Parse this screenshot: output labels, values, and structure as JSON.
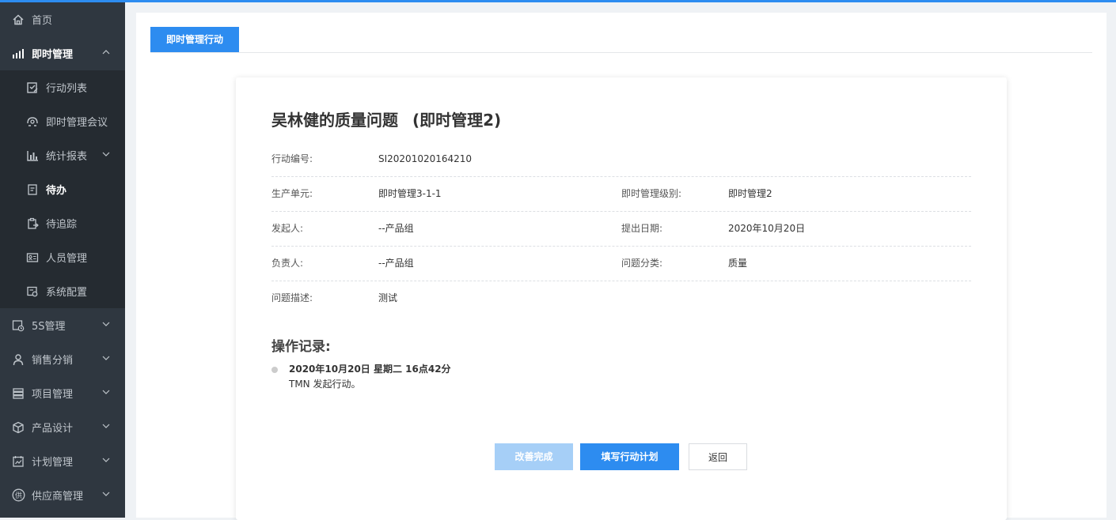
{
  "sidebar": {
    "items": [
      {
        "label": "首页",
        "icon": "home-icon"
      },
      {
        "label": "即时管理",
        "icon": "bar-signal-icon"
      },
      {
        "label": "行动列表",
        "icon": "edit-check-icon"
      },
      {
        "label": "即时管理会议",
        "icon": "meeting-icon"
      },
      {
        "label": "统计报表",
        "icon": "bar-chart-icon"
      },
      {
        "label": "待办",
        "icon": "todo-icon"
      },
      {
        "label": "待追踪",
        "icon": "tracking-icon"
      },
      {
        "label": "人员管理",
        "icon": "id-card-icon"
      },
      {
        "label": "系统配置",
        "icon": "config-icon"
      },
      {
        "label": "5S管理",
        "icon": "calendar-clock-icon"
      },
      {
        "label": "销售分销",
        "icon": "user-icon"
      },
      {
        "label": "项目管理",
        "icon": "server-icon"
      },
      {
        "label": "产品设计",
        "icon": "cube-icon"
      },
      {
        "label": "计划管理",
        "icon": "plan-icon"
      },
      {
        "label": "供应商管理",
        "icon": "supplier-icon",
        "badge": "供"
      }
    ]
  },
  "tab": {
    "label": "即时管理行动"
  },
  "card": {
    "title": "吴林健的质量问题",
    "level_title": "(即时管理2)",
    "fields": {
      "action_no_label": "行动编号:",
      "action_no": "SI20201020164210",
      "unit_label": "生产单元:",
      "unit": "即时管理3-1-1",
      "level_label": "即时管理级别:",
      "level": "即时管理2",
      "initiator_label": "发起人:",
      "initiator": "--产品组",
      "date_label": "提出日期:",
      "date": "2020年10月20日",
      "owner_label": "负责人:",
      "owner": "--产品组",
      "category_label": "问题分类:",
      "category": "质量",
      "desc_label": "问题描述:",
      "desc": "测试"
    },
    "log": {
      "title": "操作记录:",
      "time": "2020年10月20日 星期二 16点42分",
      "text": "TMN 发起行动。"
    },
    "buttons": {
      "done": "改善完成",
      "plan": "填写行动计划",
      "back": "返回"
    }
  },
  "colors": {
    "accent": "#2d8cf0",
    "sidebar": "#2f3740",
    "submenu": "#252b31"
  }
}
